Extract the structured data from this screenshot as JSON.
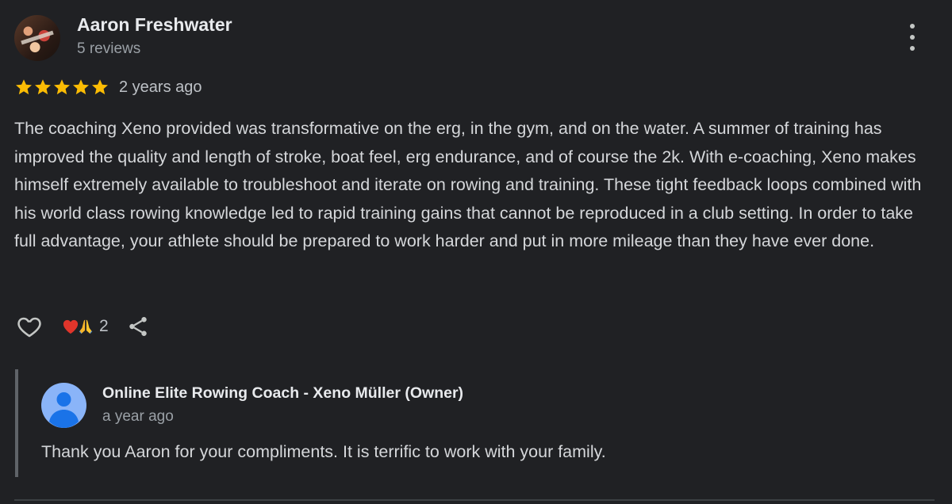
{
  "review": {
    "author_name": "Aaron Freshwater",
    "author_reviews": "5 reviews",
    "rating": 5,
    "max_rating": 5,
    "date": "2 years ago",
    "text": "The coaching Xeno provided was transformative on the erg, in the gym, and on the water. A summer of training has improved the quality and length of stroke, boat feel, erg endurance, and of course the 2k. With e-coaching, Xeno makes himself extremely available to troubleshoot and iterate on rowing and training. These tight feedback loops combined with his world class rowing knowledge led to rapid training gains that cannot be reproduced in a club setting. In order to take full advantage, your athlete should be prepared to work harder and put in more mileage than they have ever done."
  },
  "actions": {
    "like_icon": "heart-outline-icon",
    "reaction_icons": [
      "red-heart-emoji",
      "folded-hands-emoji"
    ],
    "reaction_count": "2",
    "share_icon": "share-icon",
    "more_icon": "more-vertical-icon"
  },
  "owner_reply": {
    "name": "Online Elite Rowing Coach - Xeno Müller (Owner)",
    "date": "a year ago",
    "text": "Thank you Aaron for your compliments. It is terrific to work with your family."
  },
  "colors": {
    "background": "#202124",
    "star": "#fbbc04",
    "owner_avatar": "#8ab4f8",
    "reply_border": "#5f6368"
  }
}
